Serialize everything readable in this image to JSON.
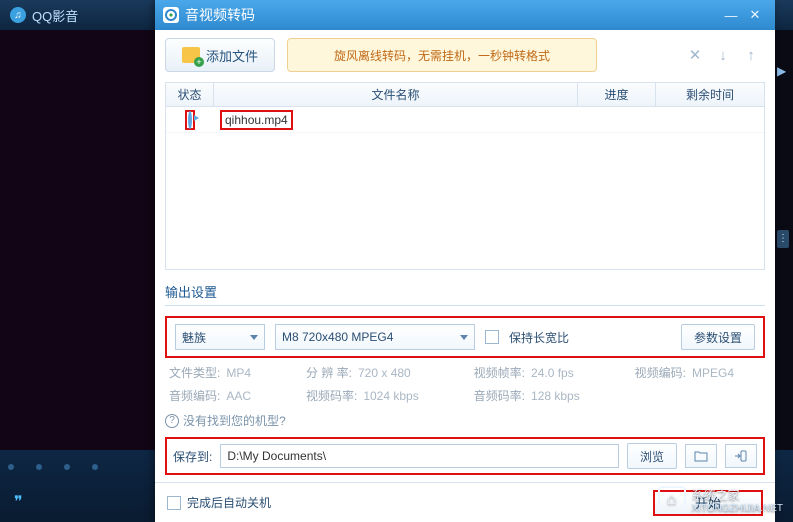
{
  "app": {
    "title": "QQ影音"
  },
  "dialog": {
    "title": "音视频转码",
    "add_file": "添加文件",
    "banner": "旋风离线转码，无需挂机，一秒钟转格式",
    "table": {
      "headers": {
        "status": "状态",
        "filename": "文件名称",
        "progress": "进度",
        "remaining": "剩余时间"
      },
      "rows": [
        {
          "status": "ready",
          "filename": "qihhou.mp4",
          "progress": "",
          "remaining": ""
        }
      ]
    },
    "output_section": "输出设置",
    "brand_select": "魅族",
    "model_select": "M8 720x480 MPEG4",
    "keep_aspect_label": "保持长宽比",
    "param_button": "参数设置",
    "specs": {
      "filetype_l": "文件类型:",
      "filetype_v": "MP4",
      "res_l": "分 辨 率:",
      "res_v": "720 x 480",
      "vfps_l": "视频帧率:",
      "vfps_v": "24.0 fps",
      "vcodec_l": "视频编码:",
      "vcodec_v": "MPEG4",
      "acodec_l": "音频编码:",
      "acodec_v": "AAC",
      "vbit_l": "视频码率:",
      "vbit_v": "1024 kbps",
      "abit_l": "音频码率:",
      "abit_v": "128 kbps"
    },
    "help_text": "没有找到您的机型?",
    "save_label": "保存到:",
    "save_path": "D:\\My Documents\\",
    "browse": "浏览",
    "shutdown_label": "完成后自动关机",
    "start": "开始"
  },
  "watermark": {
    "name": "系统之家",
    "url": "XITONGZHIJIA.NET"
  }
}
